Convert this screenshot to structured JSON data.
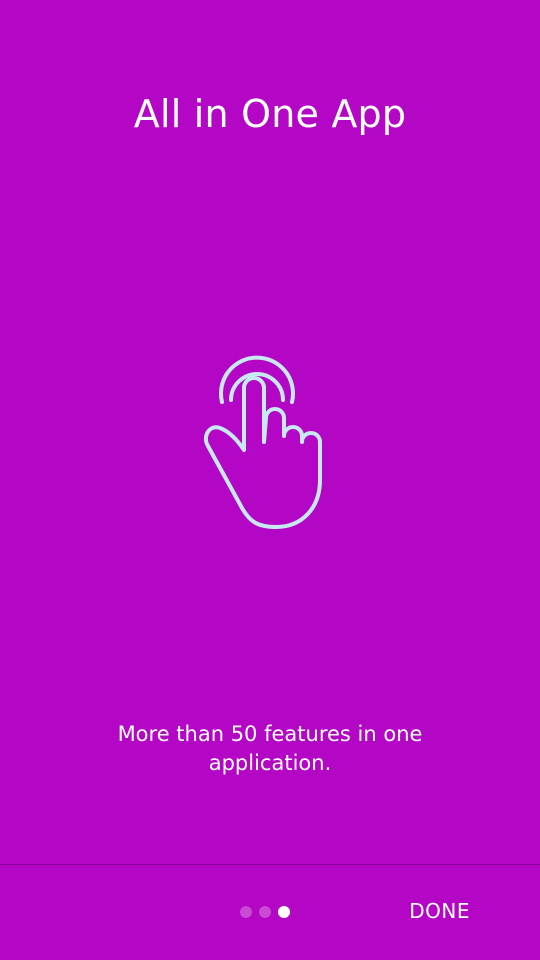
{
  "onboarding": {
    "title": "All in One App",
    "description": "More than 50 features in one application.",
    "illustration_icon": "tap-gesture-hand-icon",
    "pager": {
      "total": 3,
      "active_index": 2
    },
    "done_label": "DONE"
  },
  "colors": {
    "background": "#b406c5",
    "icon_stroke": "#c6e9f4",
    "text": "#ffffff"
  }
}
